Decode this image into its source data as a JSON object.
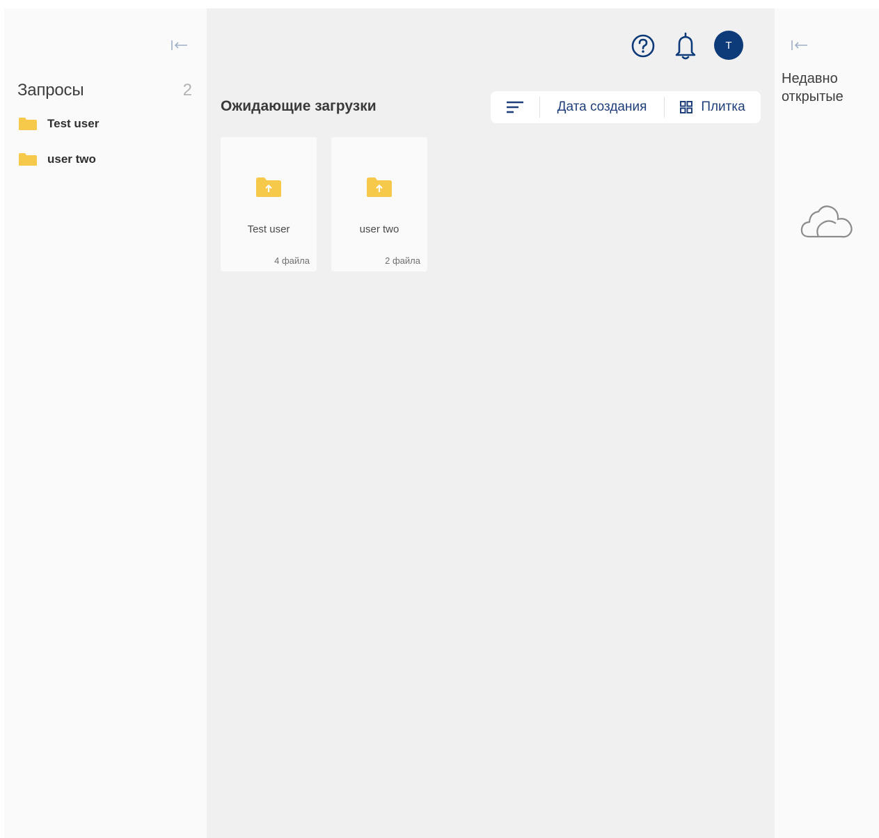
{
  "left_sidebar": {
    "title": "Запросы",
    "count": "2",
    "items": [
      {
        "label": "Test user",
        "icon": "folder-icon"
      },
      {
        "label": "user two",
        "icon": "folder-icon"
      }
    ],
    "collapse_icon": "collapse-left-icon"
  },
  "header": {
    "help_icon": "help-circle-icon",
    "notifications_icon": "bell-icon",
    "avatar_initial": "T"
  },
  "main": {
    "title": "Ожидающие загрузки",
    "toolbar": {
      "sort_icon": "sort-lines-icon",
      "sort_label": "Дата создания",
      "view_icon": "grid-icon",
      "view_label": "Плитка"
    },
    "tiles": [
      {
        "name": "Test user",
        "count": "4 файла",
        "icon": "folder-upload-icon"
      },
      {
        "name": "user two",
        "count": "2 файла",
        "icon": "folder-upload-icon"
      }
    ]
  },
  "right_panel": {
    "title": "Недавно открытые",
    "collapse_icon": "collapse-left-icon",
    "empty_icon": "cloud-icon"
  },
  "colors": {
    "accent": "#0d3a78",
    "link": "#1f3f7a",
    "folder": "#f7c94b",
    "main_bg": "#f1f0f0",
    "panel_bg": "#fafafa"
  }
}
